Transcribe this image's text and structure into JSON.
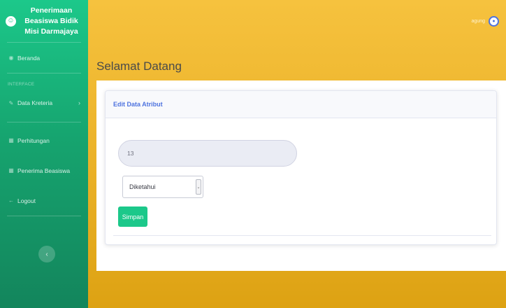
{
  "brand": {
    "line1": "Penerimaan",
    "line2": "Beasiswa Bidik",
    "line3": "Misi Darmajaya",
    "logo_icon": "smile-icon"
  },
  "sidebar": {
    "items": [
      {
        "label": "Beranda",
        "icon": "dashboard-icon"
      },
      {
        "label": "Data Kreteria",
        "icon": "wrench-icon"
      },
      {
        "label": "Perhitungan",
        "icon": "table-icon"
      },
      {
        "label": "Penerima Beasiswa",
        "icon": "table-icon"
      },
      {
        "label": "Logout",
        "icon": "arrow-left-icon"
      }
    ],
    "heading": "INTERFACE",
    "toggle_icon": "chevron-left-icon"
  },
  "topbar": {
    "user_name": "agung",
    "avatar_icon": "user-avatar-icon"
  },
  "page": {
    "title": "Selamat Datang"
  },
  "card": {
    "header": "Edit Data Atribut",
    "input_value": "13",
    "select_value": "Diketahui",
    "save_label": "Simpan"
  },
  "colors": {
    "sidebar": "#1cc88a",
    "main_background": "#f6c23e",
    "card_header_text": "#4e73df",
    "save_button": "#1cc88a"
  }
}
